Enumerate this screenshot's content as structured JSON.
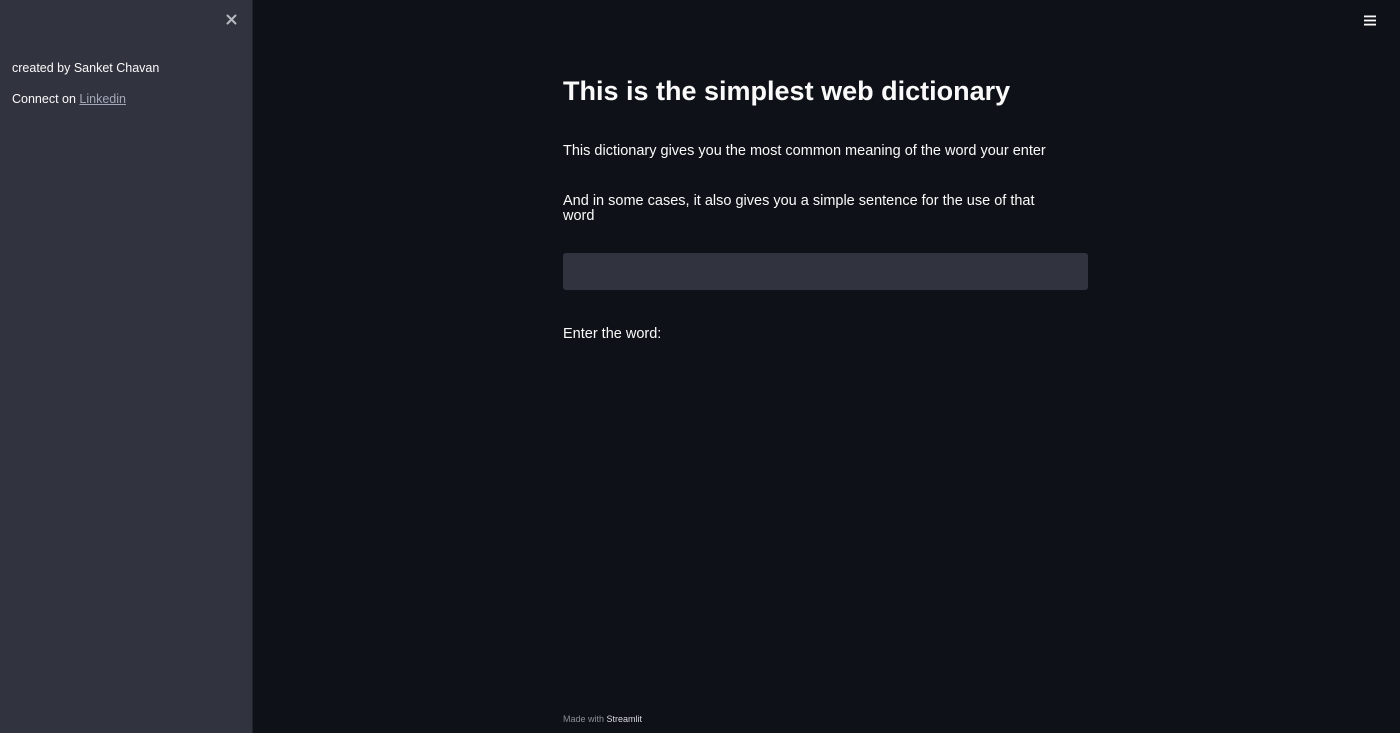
{
  "sidebar": {
    "created_by": "created by Sanket Chavan",
    "connect_prefix": "Connect on ",
    "connect_link": "Linkedin"
  },
  "main": {
    "title": "This is the simplest web dictionary",
    "description_1": "This dictionary gives you the most common meaning of the word your enter",
    "description_2": "And in some cases, it also gives you a simple sentence for the use of that word",
    "input_value": "",
    "input_label": "Enter the word:"
  },
  "footer": {
    "prefix": "Made with",
    "brand": "Streamlit"
  },
  "icons": {
    "close": "close-icon",
    "menu": "hamburger-menu-icon"
  },
  "colors": {
    "main_background": "#0e1117",
    "sidebar_background": "#31333f",
    "input_background": "#31333f",
    "text": "#fafafa",
    "link": "#a3a8b8"
  }
}
